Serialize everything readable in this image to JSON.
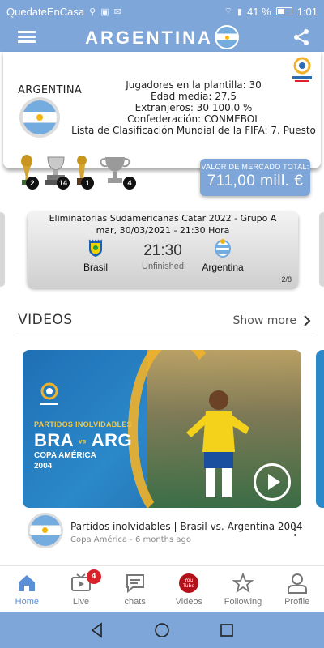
{
  "status_bar": {
    "left_text": "QuedateEnCasa",
    "battery_percent": "41 %",
    "time": "1:01"
  },
  "app_bar": {
    "title": "ARGENTINA"
  },
  "team": {
    "name": "ARGENTINA",
    "info_lines": [
      "Jugadores en la plantilla: 30",
      "Edad media: 27,5",
      "Extranjeros: 30   100,0 %",
      "Confederación: CONMEBOL",
      "Lista de Clasificación Mundial de la FIFA: 7. Puesto"
    ],
    "trophies": [
      {
        "icon": "world-cup-trophy-icon",
        "count": "2"
      },
      {
        "icon": "copa-america-trophy-icon",
        "count": "14"
      },
      {
        "icon": "confederations-cup-trophy-icon",
        "count": "1"
      },
      {
        "icon": "cup-trophy-icon",
        "count": "4"
      }
    ],
    "market_value_label": "VALOR DE MERCADO TOTAL:",
    "market_value": "711,00 mill. €"
  },
  "match": {
    "competition": "Eliminatorias Sudamericanas Catar 2022 - Grupo A",
    "date": "mar, 30/03/2021 - 21:30 Hora",
    "home": "Brasil",
    "away": "Argentina",
    "time": "21:30",
    "status": "Unfinished",
    "page": "2/8"
  },
  "videos": {
    "section_title": "VIDEOS",
    "show_more": "Show more",
    "thumb": {
      "line1": "PARTIDOS INOLVIDABLES",
      "team_a": "BRA",
      "vs": "vs",
      "team_b": "ARG",
      "line3": "COPA AMÉRICA",
      "line4": "2004"
    },
    "item": {
      "title": "Partidos inolvidables | Brasil vs. Argentina 2004",
      "subtitle": "Copa América - 6 months ago"
    }
  },
  "bottom_nav": [
    {
      "label": "Home",
      "icon": "home-icon",
      "active": true
    },
    {
      "label": "Live",
      "icon": "tv-icon",
      "badge": "4"
    },
    {
      "label": "chats",
      "icon": "chat-icon"
    },
    {
      "label": "Videos",
      "icon": "youtube-icon"
    },
    {
      "label": "Following",
      "icon": "star-icon"
    },
    {
      "label": "Profile",
      "icon": "person-icon"
    }
  ],
  "colors": {
    "primary": "#7ea6d8",
    "accent_blue": "#5b8fd6",
    "badge_red": "#d9232a"
  }
}
